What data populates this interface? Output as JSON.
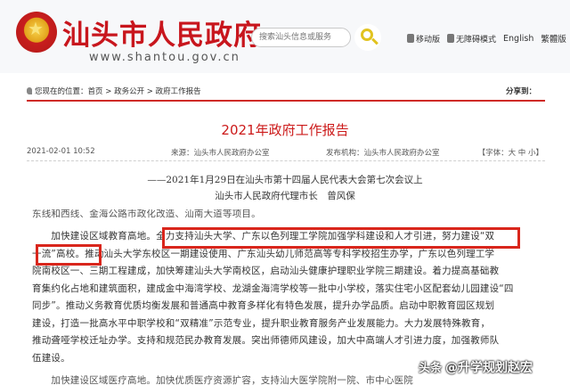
{
  "header": {
    "site_title": "汕头市人民政府",
    "site_url": "www.shantou.gov.cn",
    "search_placeholder": "搜索汕头信息或服务",
    "tools": {
      "mobile": "移动版",
      "accessible": "无障碍模式",
      "english": "English",
      "traditional": "繁體版"
    }
  },
  "breadcrumb": {
    "prefix": "您现在的位置：",
    "items": [
      "首页",
      "政务公开",
      "政府工作报告"
    ],
    "separator": " > ",
    "share_label": "分享到："
  },
  "document": {
    "title": "2021年政府工作报告",
    "date": "2021-02-01 10:52",
    "source": "来源：汕头市人民政府办公室",
    "publisher": "发布机构：汕头市人民政府办公室",
    "font_size": "【字体：大 中 小】",
    "subtitle_line1": "——2021年1月29日在汕头市第十四届人民代表大会第七次会议上",
    "subtitle_line2": "汕头市人民政府代理市长　曾风保",
    "partial_top": "东线和西线、金海公路市政化改造、汕南大道等项目。",
    "paragraph_lines": [
      "　　加快建设区域教育高地。全力支持汕头大学、广东以色列理工学院加强学科建设和人才引进，努力建设“双",
      "一流”高校。推动汕头大学东校区一期建设使用、广东汕头幼儿师范高等专科学校招生办学，广东以色列理工学",
      "院南校区一、三期工程建成，加快筹建汕头大学南校区，启动汕头健康护理职业学院三期建设。着力提高基础教",
      "育集约化占地和建筑面积，建成金中海湾学校、龙湖金海湾学校等一批中小学校，落实住宅小区配套幼儿园建设“四",
      "同步”。推动义务教育优质均衡发展和普通高中教育多样化有特色发展，提升办学品质。启动中职教育园区规划",
      "建设，打造一批高水平中职学校和“双精准”示范专业，提升职业教育服务产业发展能力。大力发展特殊教育，",
      "推动聋哑学校迁址办学。支持和规范民办教育发展。突出师德师风建设，加大中高端人才引进力度，加强教师队",
      "伍建设。"
    ],
    "partial_bottom": "　　加快建设区域医疗高地。加快优质医疗资源扩容，支持汕大医学院附一院、市中心医院"
  },
  "watermark": {
    "brand": "头条",
    "author": "@升学规划赵宏"
  },
  "colors": {
    "brand_red": "#c8161d",
    "title_red": "#cc1a1a",
    "highlight_red": "#d9261c",
    "search_yellow": "#e1c320"
  }
}
